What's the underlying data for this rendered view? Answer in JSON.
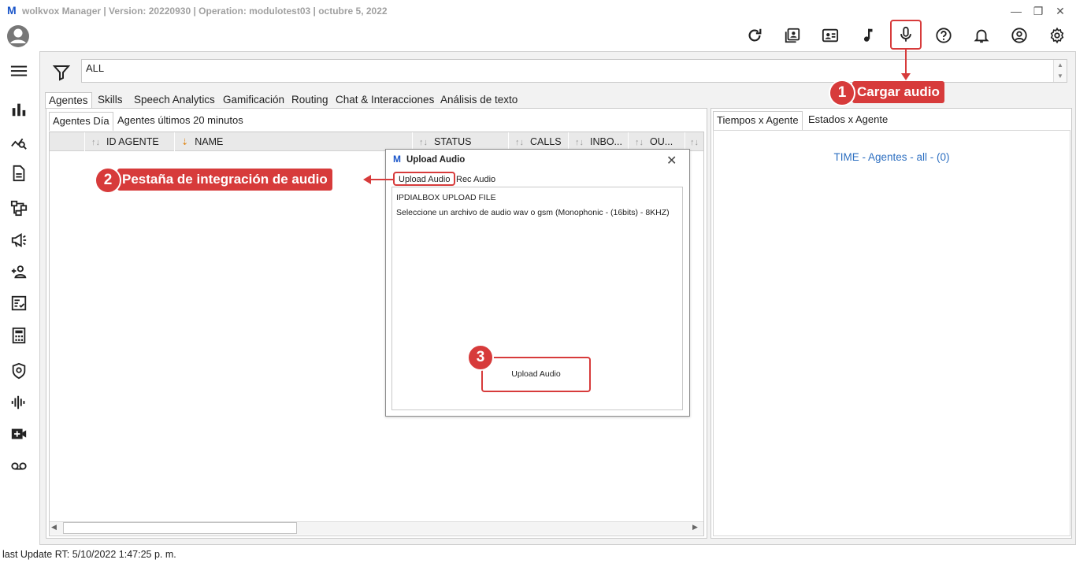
{
  "titlebar": {
    "logo": "M",
    "text": "wolkvox Manager  | Version: 20220930 |  Operation: modulotest03 | octubre 5, 2022",
    "minimize": "—",
    "restore": "❐",
    "close": "✕"
  },
  "filter": {
    "value": "ALL"
  },
  "main_tabs": [
    "Agentes",
    "Skills",
    "Speech Analytics",
    "Gamificación",
    "Routing",
    "Chat & Interacciones",
    "Análisis de texto"
  ],
  "left_subtabs": [
    "Agentes Día",
    "Agentes últimos 20 minutos"
  ],
  "grid_columns": [
    "ID AGENTE",
    "NAME",
    "STATUS",
    "CALLS",
    "INBO...",
    "OU..."
  ],
  "right_subtabs": [
    "Tiempos x Agente",
    "Estados x Agente"
  ],
  "right_panel": {
    "time_text": "TIME - Agentes - all -  (0)"
  },
  "dialog": {
    "logo": "M",
    "title": "Upload Audio",
    "close": "✕",
    "tabs": [
      "Upload Audio",
      "Rec Audio"
    ],
    "line1": "IPDIALBOX UPLOAD FILE",
    "line2": "Seleccione un archivo de audio wav o gsm (Monophonic - (16bits) - 8KHZ)",
    "button_label": "Upload Audio"
  },
  "callouts": {
    "c1": {
      "number": "1",
      "label": "Cargar audio"
    },
    "c2": {
      "number": "2",
      "label": "Pestaña de integración de audio"
    },
    "c3": {
      "number": "3"
    }
  },
  "statusbar": {
    "text": "last Update RT: 5/10/2022 1:47:25 p. m."
  },
  "colors": {
    "callout": "#d73b3b",
    "link_blue": "#2d6fc1",
    "brand": "#1a55c9"
  }
}
